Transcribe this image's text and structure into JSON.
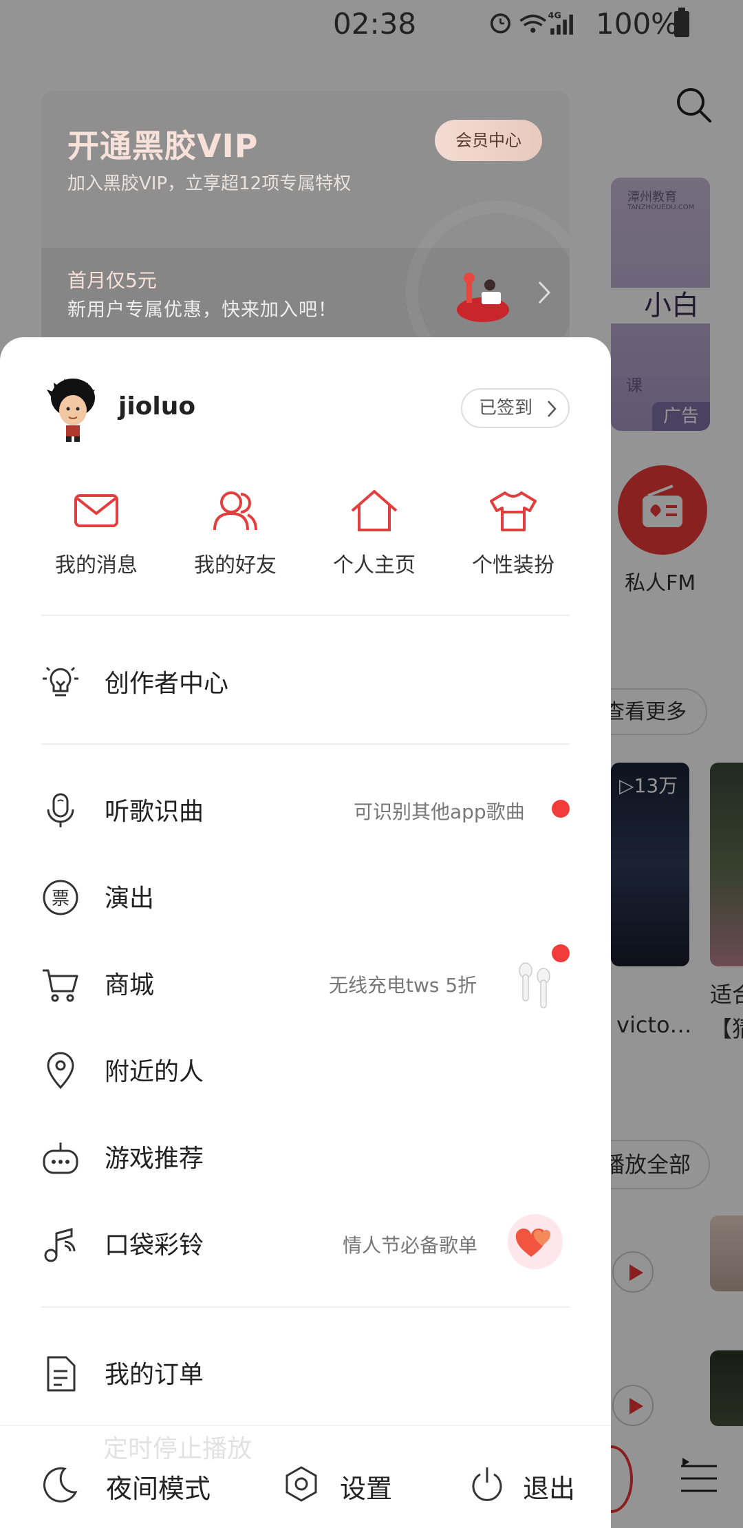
{
  "status_bar": {
    "time": "02:38",
    "battery": "100%",
    "network": "4G"
  },
  "background": {
    "banner_org": "潭州教育",
    "banner_org_sub": "TANZHOUEDU.COM",
    "banner_big": "小白",
    "banner_ke": "课",
    "banner_ad": "广告",
    "fm_label": "私人FM",
    "see_more": "查看更多",
    "play_count": "▷13万",
    "song_title_1": "victo…",
    "song_title_2": "适合",
    "song_title_2b": "【猜",
    "play_all": "播放全部"
  },
  "vip": {
    "title": "开通黑胶VIP",
    "subtitle": "加入黑胶VIP，立享超12项专属特权",
    "member_button": "会员中心",
    "promo_title": "首月仅5元",
    "promo_sub": "新用户专属优惠，快来加入吧！"
  },
  "user": {
    "name": "jioluo",
    "signin_label": "已签到"
  },
  "quick_actions": [
    {
      "label": "我的消息",
      "icon": "mail-icon"
    },
    {
      "label": "我的好友",
      "icon": "friends-icon"
    },
    {
      "label": "个人主页",
      "icon": "home-icon"
    },
    {
      "label": "个性装扮",
      "icon": "tshirt-icon"
    }
  ],
  "menu": {
    "creator": {
      "label": "创作者中心",
      "icon": "lightbulb-icon"
    },
    "recognize": {
      "label": "听歌识曲",
      "hint": "可识别其他app歌曲",
      "icon": "microphone-icon"
    },
    "shows": {
      "label": "演出",
      "icon": "ticket-icon"
    },
    "mall": {
      "label": "商城",
      "hint": "无线充电tws 5折",
      "icon": "cart-icon"
    },
    "nearby": {
      "label": "附近的人",
      "icon": "location-icon"
    },
    "games": {
      "label": "游戏推荐",
      "icon": "gamepad-icon"
    },
    "ringtone": {
      "label": "口袋彩铃",
      "hint": "情人节必备歌单",
      "icon": "music-note-icon"
    },
    "orders": {
      "label": "我的订单",
      "icon": "document-icon"
    },
    "ghost": "定时停止播放"
  },
  "footer": {
    "night_mode": "夜间模式",
    "settings": "设置",
    "logout": "退出"
  },
  "colors": {
    "accent": "#e33e3e",
    "dot": "#f23b3b",
    "text": "#222222",
    "hint": "#777777"
  }
}
